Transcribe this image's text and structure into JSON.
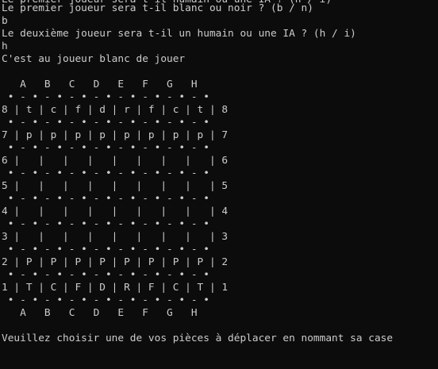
{
  "console": {
    "partial_top": "Le premier joueur sera t-il humain ou une IA ? (h / i)",
    "lines": [
      "Le premier joueur sera t-il blanc ou noir ? (b / n)",
      "b",
      "Le deuxième joueur sera t-il un humain ou une IA ? (h / i)",
      "h",
      "C'est au joueur blanc de jouer",
      "",
      "   A   B   C   D   E   F   G   H",
      " • - • - • - • - • - • - • - • - •",
      "8 | t | c | f | d | r | f | c | t | 8",
      " • - • - • - • - • - • - • - • - •",
      "7 | p | p | p | p | p | p | p | p | 7",
      " • - • - • - • - • - • - • - • - •",
      "6 |   |   |   |   |   |   |   |   | 6",
      " • - • - • - • - • - • - • - • - •",
      "5 |   |   |   |   |   |   |   |   | 5",
      " • - • - • - • - • - • - • - • - •",
      "4 |   |   |   |   |   |   |   |   | 4",
      " • - • - • - • - • - • - • - • - •",
      "3 |   |   |   |   |   |   |   |   | 3",
      " • - • - • - • - • - • - • - • - •",
      "2 | P | P | P | P | P | P | P | P | 2",
      " • - • - • - • - • - • - • - • - •",
      "1 | T | C | F | D | R | F | C | T | 1",
      " • - • - • - • - • - • - • - • - •",
      "   A   B   C   D   E   F   G   H",
      "",
      "Veuillez choisir une de vos pièces à déplacer en nommant sa case"
    ]
  }
}
